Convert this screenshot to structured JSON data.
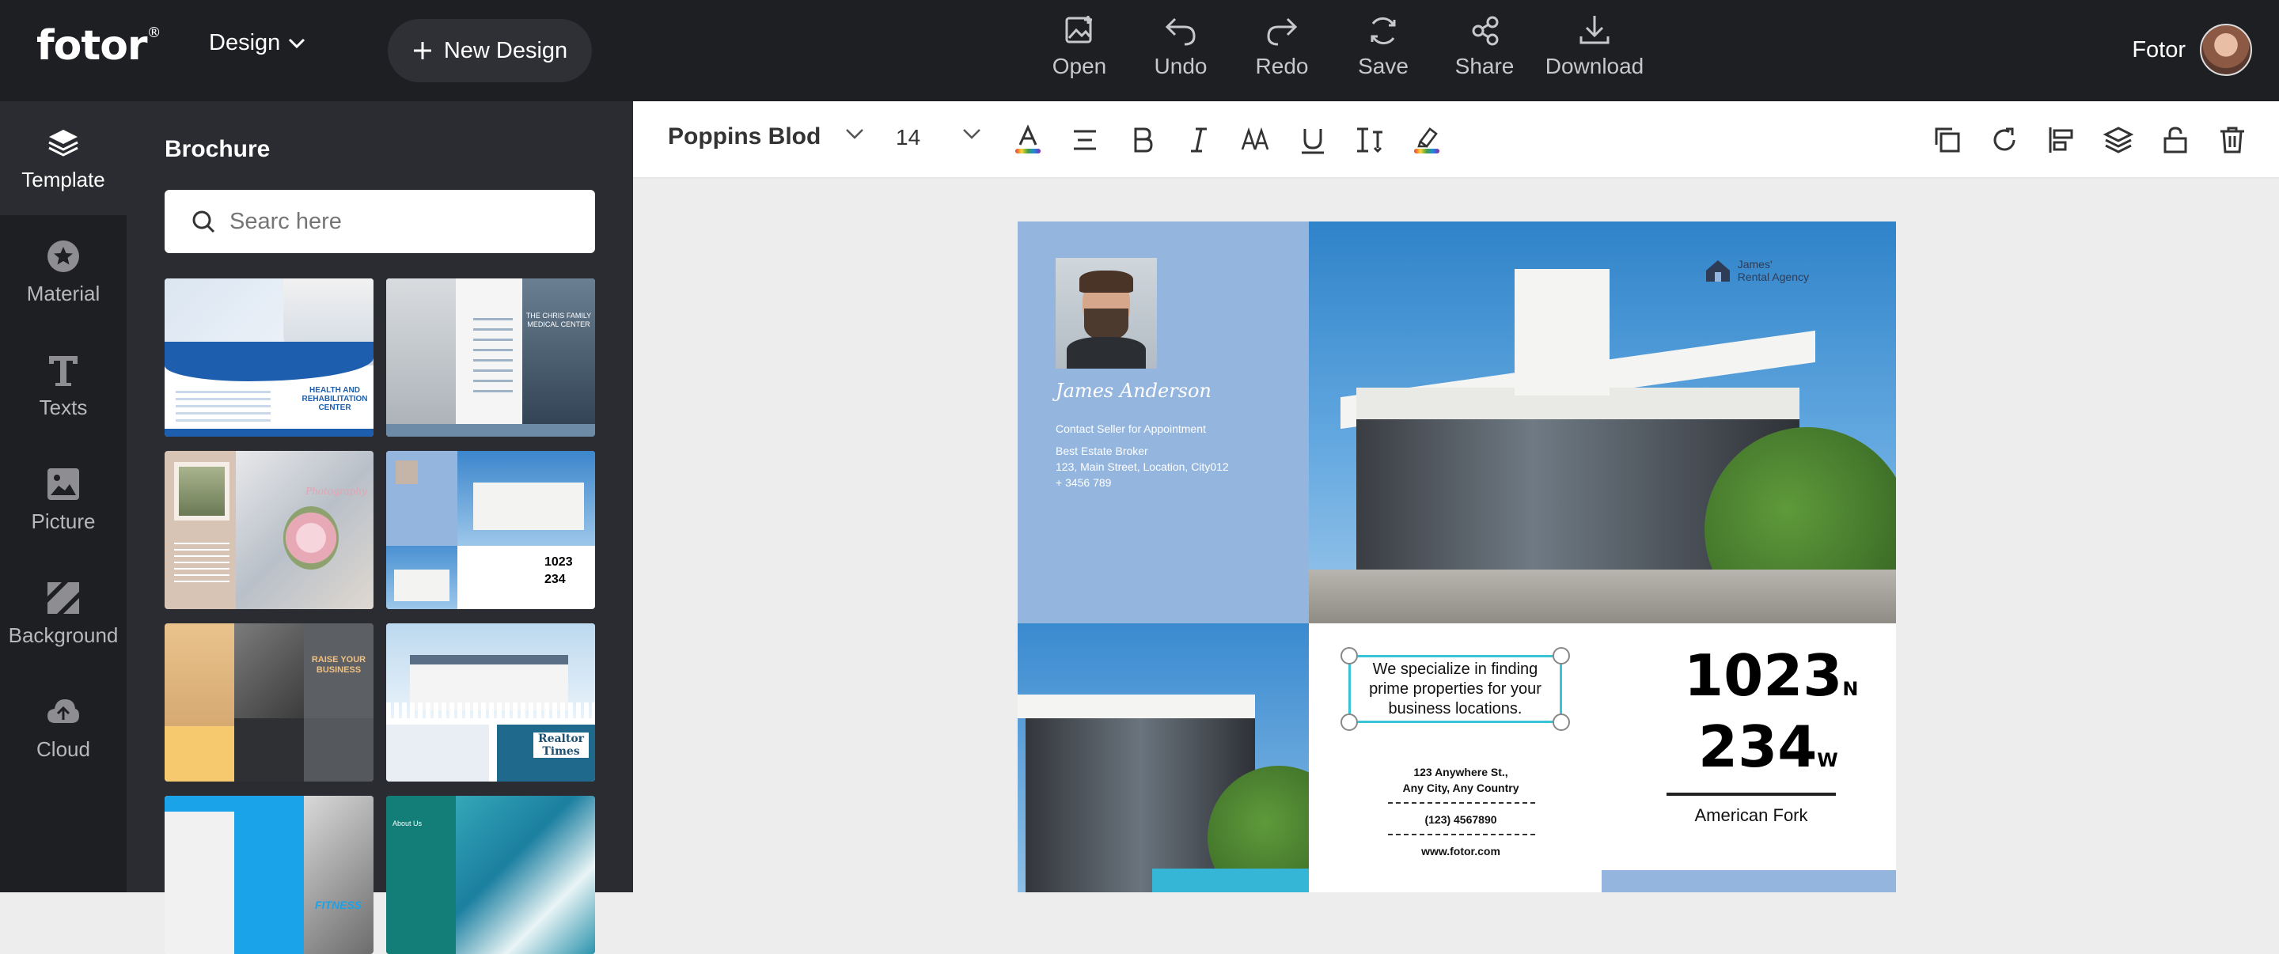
{
  "app": {
    "logo": "fotor",
    "logo_mark": "®",
    "design_menu": "Design",
    "new_design": "New Design",
    "user_name": "Fotor"
  },
  "toolbar": [
    {
      "label": "Open",
      "icon": "open-image-icon"
    },
    {
      "label": "Undo",
      "icon": "undo-icon"
    },
    {
      "label": "Redo",
      "icon": "redo-icon"
    },
    {
      "label": "Save",
      "icon": "save-icon"
    },
    {
      "label": "Share",
      "icon": "share-icon"
    },
    {
      "label": "Download",
      "icon": "download-icon"
    }
  ],
  "sidebar": {
    "items": [
      {
        "label": "Template",
        "icon": "layers-icon",
        "active": true
      },
      {
        "label": "Material",
        "icon": "star-icon"
      },
      {
        "label": "Texts",
        "icon": "text-icon"
      },
      {
        "label": "Picture",
        "icon": "picture-icon"
      },
      {
        "label": "Background",
        "icon": "background-icon"
      },
      {
        "label": "Cloud",
        "icon": "cloud-icon"
      }
    ]
  },
  "panel": {
    "title": "Brochure",
    "search_placeholder": "Searc here"
  },
  "templates": [
    {
      "name": "health-rehab",
      "text": "HEALTH AND REHABILITATION CENTER"
    },
    {
      "name": "medical-center",
      "text": "THE CHRIS FAMILY MEDICAL CENTER"
    },
    {
      "name": "photography",
      "text": "Photography"
    },
    {
      "name": "real-estate",
      "text": "1023 234"
    },
    {
      "name": "business",
      "text": "RAISE YOUR BUSINESS"
    },
    {
      "name": "realtor-times",
      "text": "Realtor Times"
    },
    {
      "name": "fitness",
      "text": "FITNESS"
    },
    {
      "name": "ocean",
      "text": "About Us"
    }
  ],
  "properties": {
    "font": "Poppins Blod",
    "size": "14",
    "rainbow_colors": [
      "#e53935",
      "#fb8c00",
      "#fdd835",
      "#43a047",
      "#1e88e5",
      "#8e24aa"
    ]
  },
  "canvas": {
    "agent_name": "James Anderson",
    "contact_line": "Contact Seller for Appointment",
    "role": "Best Estate Broker",
    "address": "123, Main Street, Location, City012",
    "phone": "+ 3456 789",
    "agency_line1": "James'",
    "agency_line2": "Rental Agency",
    "specialize": "We specialize in finding prime properties for your business locations.",
    "contact_address1": "123 Anywhere St.,",
    "contact_address2": "Any City, Any Country",
    "contact_phone": "(123) 4567890",
    "contact_web": "www.fotor.com",
    "num1": "1023",
    "num1_suffix": "N",
    "num2": "234",
    "num2_suffix": "W",
    "city": "American Fork"
  },
  "colors": {
    "topbar": "#1e1f23",
    "panel": "#2b2c31",
    "brochure_blue": "#94b6de",
    "selection": "#38c3d6"
  }
}
